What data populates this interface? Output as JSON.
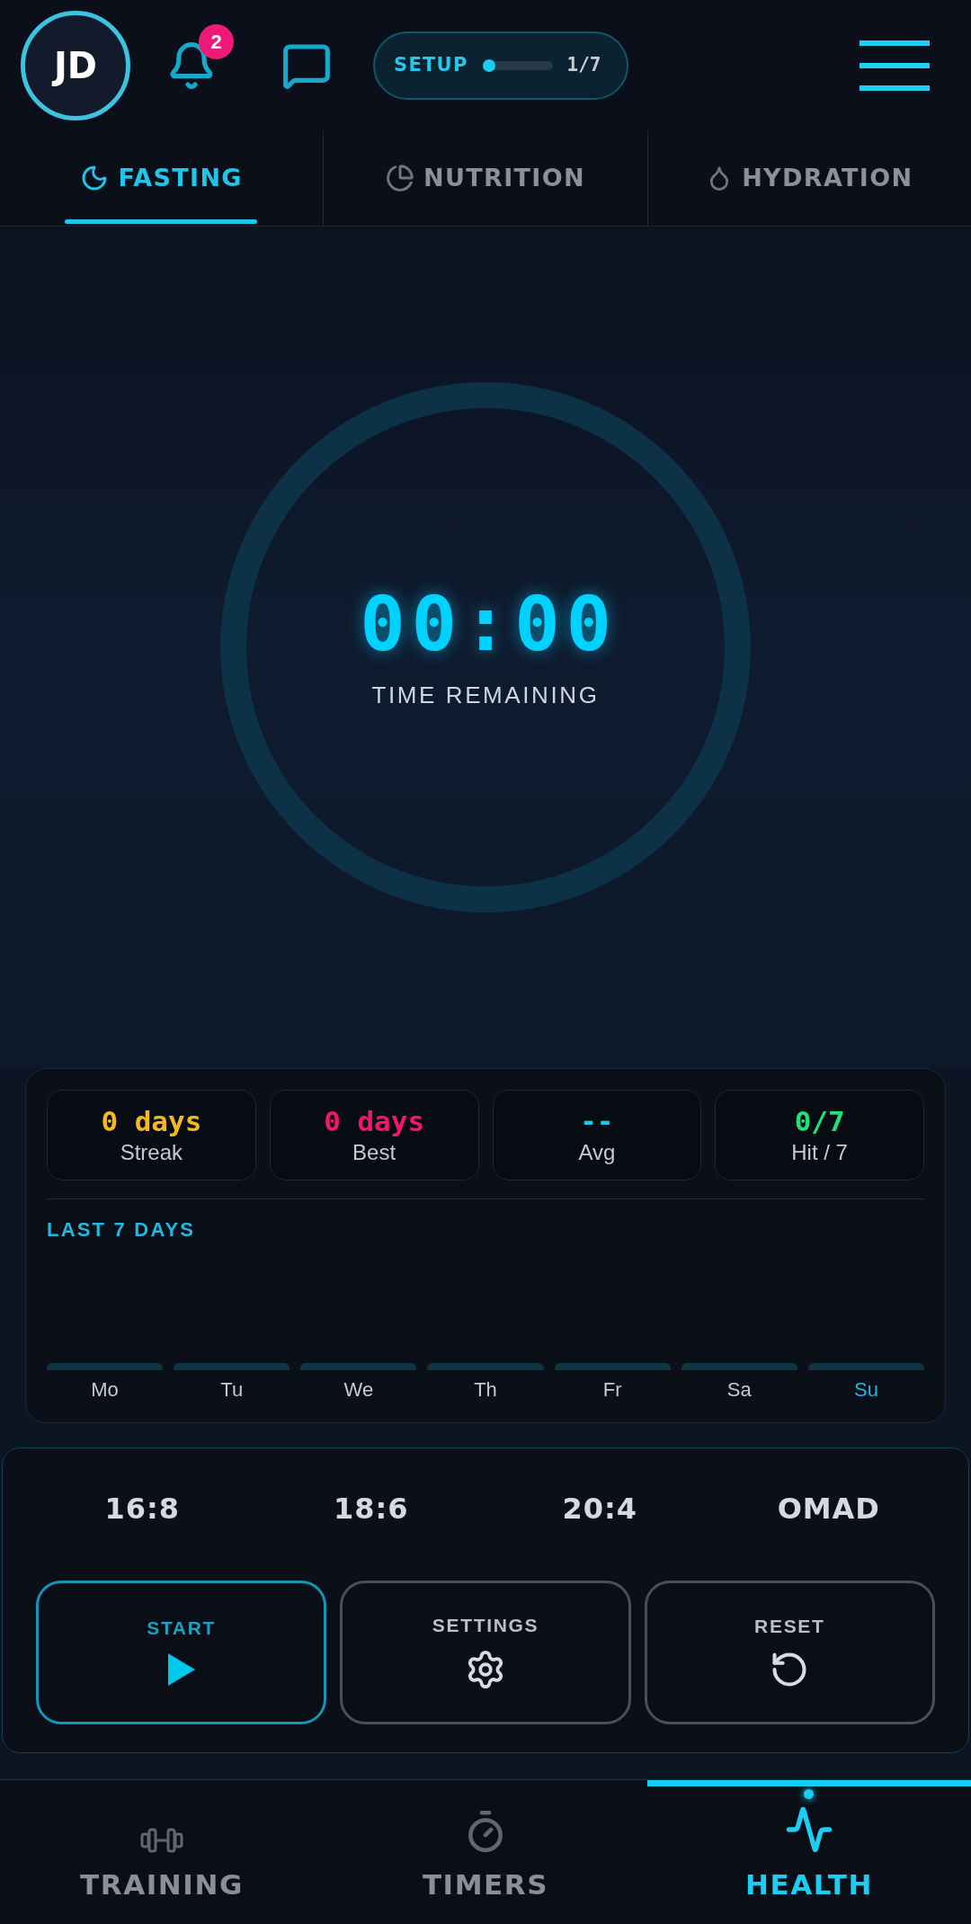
{
  "header": {
    "avatar": {
      "initials": "JD"
    },
    "notifications": {
      "badge": "2"
    },
    "setup": {
      "label": "SETUP",
      "level": 0.14,
      "progress": "1/7"
    }
  },
  "tabs": [
    {
      "label": "FASTING",
      "selected": true
    },
    {
      "label": "NUTRITION",
      "selected": false
    },
    {
      "label": "HYDRATION",
      "selected": false
    }
  ],
  "timer": {
    "time": "00:00",
    "caption": "TIME REMAINING"
  },
  "stats": [
    {
      "value": "0 days",
      "label": "Streak",
      "color": "#f5b91e"
    },
    {
      "value": "0 days",
      "label": "Best",
      "color": "#f2176c"
    },
    {
      "value": "--",
      "label": "Avg",
      "color": "#1ec8ec"
    },
    {
      "value": "0/7",
      "label": "Hit / 7",
      "color": "#1fe27d"
    }
  ],
  "history": {
    "title": "LAST 7 DAYS",
    "days": [
      {
        "label": "Mo",
        "today": false
      },
      {
        "label": "Tu",
        "today": false
      },
      {
        "label": "We",
        "today": false
      },
      {
        "label": "Th",
        "today": false
      },
      {
        "label": "Fr",
        "today": false
      },
      {
        "label": "Sa",
        "today": false
      },
      {
        "label": "Su",
        "today": true
      }
    ]
  },
  "presets": [
    {
      "label": "16:8",
      "selected": false
    },
    {
      "label": "18:6",
      "selected": false
    },
    {
      "label": "20:4",
      "selected": false
    },
    {
      "label": "OMAD",
      "selected": false
    }
  ],
  "actions": [
    {
      "label": "START",
      "kind": "primary"
    },
    {
      "label": "SETTINGS",
      "kind": "secondary"
    },
    {
      "label": "RESET",
      "kind": "secondary"
    }
  ],
  "navigation": [
    {
      "label": "TRAINING",
      "selected": false
    },
    {
      "label": "TIMERS",
      "selected": false
    },
    {
      "label": "HEALTH",
      "selected": true
    }
  ]
}
